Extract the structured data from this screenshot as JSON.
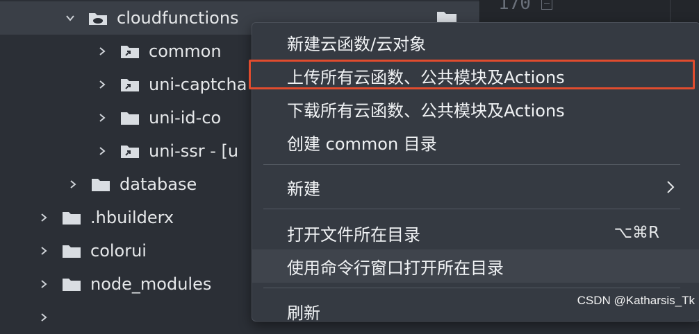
{
  "editor": {
    "line_number": "170"
  },
  "tree": {
    "items": [
      {
        "label": "cloudfunctions",
        "expanded": true,
        "icon": "cloud-folder-icon"
      },
      {
        "label": "common",
        "expanded": false,
        "icon": "linked-folder-icon"
      },
      {
        "label": "uni-captcha",
        "expanded": false,
        "icon": "linked-folder-icon"
      },
      {
        "label": "uni-id-co",
        "expanded": false,
        "icon": "folder-icon"
      },
      {
        "label": "uni-ssr - [u",
        "expanded": false,
        "icon": "linked-folder-icon"
      },
      {
        "label": "database",
        "expanded": false,
        "icon": "folder-icon"
      },
      {
        "label": ".hbuilderx",
        "expanded": false,
        "icon": "folder-icon"
      },
      {
        "label": "colorui",
        "expanded": false,
        "icon": "folder-icon"
      },
      {
        "label": "node_modules",
        "expanded": false,
        "icon": "folder-icon"
      }
    ]
  },
  "menu": {
    "items": [
      {
        "label": "新建云函数/云对象"
      },
      {
        "label": "上传所有云函数、公共模块及Actions"
      },
      {
        "label": "下载所有云函数、公共模块及Actions"
      },
      {
        "label": "创建 common 目录"
      },
      {
        "label": "新建"
      },
      {
        "label": "打开文件所在目录",
        "shortcut": "⌥⌘R"
      },
      {
        "label": "使用命令行窗口打开所在目录"
      },
      {
        "label": "刷新"
      }
    ]
  },
  "colors": {
    "highlight": "#e14c2e",
    "menu_bg": "#353a42",
    "tree_bg": "#2b2f36"
  },
  "watermark": "CSDN @Katharsis_Tk"
}
